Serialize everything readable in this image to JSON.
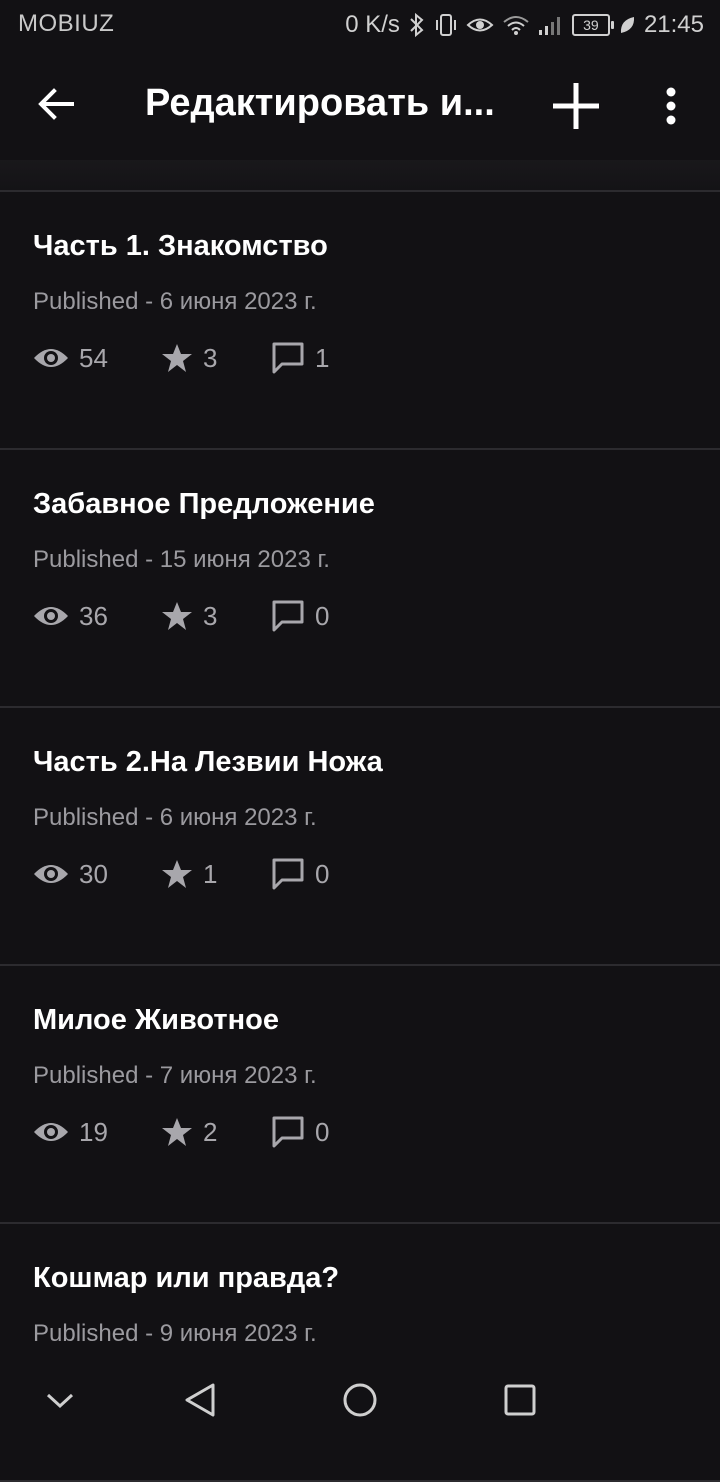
{
  "status_bar": {
    "carrier": "MOBIUZ",
    "net_speed": "0 K/s",
    "battery": "39",
    "time": "21:45"
  },
  "app_bar": {
    "title": "Редактировать и...",
    "icons": [
      "back-arrow-icon",
      "plus-icon",
      "more-vertical-icon"
    ]
  },
  "parts": [
    {
      "title": "Часть 1. Знакомство",
      "status": "Published - 6 июня 2023 г.",
      "views": "54",
      "votes": "3",
      "comments": "1"
    },
    {
      "title": "Забавное Предложение",
      "status": "Published - 15 июня 2023 г.",
      "views": "36",
      "votes": "3",
      "comments": "0"
    },
    {
      "title": "Часть 2.На Лезвии Ножа",
      "status": "Published - 6 июня 2023 г.",
      "views": "30",
      "votes": "1",
      "comments": "0"
    },
    {
      "title": "Милое Животное",
      "status": "Published - 7 июня 2023 г.",
      "views": "19",
      "votes": "2",
      "comments": "0"
    },
    {
      "title": "Кошмар или правда?",
      "status": "Published - 9 июня 2023 г."
    }
  ],
  "colors": {
    "background": "#121114",
    "divider": "#2c2b2f",
    "text_primary": "#ffffff",
    "text_secondary": "#9b9a9f"
  },
  "nav_bar": {
    "icons": [
      "chevron-down-icon",
      "back-triangle-icon",
      "home-circle-icon",
      "recents-square-icon"
    ]
  }
}
